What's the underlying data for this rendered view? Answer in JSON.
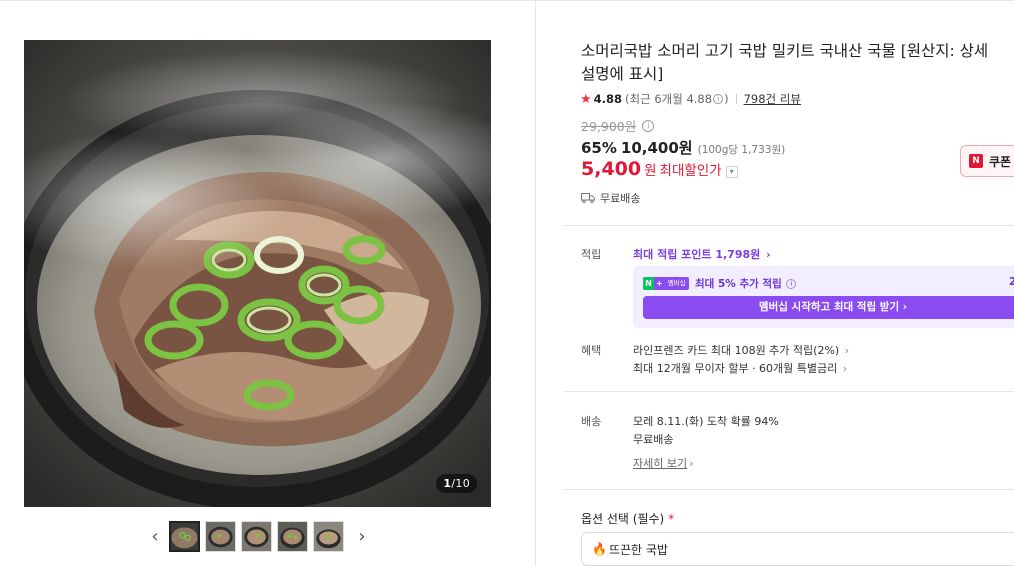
{
  "gallery": {
    "counter_current": "1",
    "counter_total": "/10",
    "prev_icon": "chevron-left-icon",
    "next_icon": "chevron-right-icon",
    "thumbnail_count": 5
  },
  "product": {
    "title": "소머리국밥 소머리 고기 국밥 밀키트 국내산 국물 [원산지: 상세설명에 표시]",
    "rating": "4.88",
    "recent_rating": "(최근 6개월 4.88",
    "recent_rating_close": ")",
    "review_count": "798건 리뷰",
    "original_price": "29,900원",
    "discount_rate": "65%",
    "sale_price": "10,400원",
    "unit_price": "(100g당 1,733원)",
    "max_discount_price": "5,400",
    "max_discount_unit": "원",
    "max_discount_label": "최대할인가",
    "shipping_short": "무료배송",
    "coupon_label": "쿠폰",
    "coupon_icon": "N"
  },
  "points": {
    "label": "적립",
    "link": "최대 적립 포인트 1,798원",
    "badge_n": "N",
    "badge_plus": "+",
    "badge_text": "멤버십",
    "extra": "최대 5% 추가 적립",
    "right_value": "2",
    "membership_button": "멤버십 시작하고 최대 적립 받기"
  },
  "benefits": {
    "label": "혜택",
    "card": "라인프렌즈 카드 최대 108원 추가 적립(2%)",
    "installment": "최대 12개월 무이자 할부 · 60개월 특별금리"
  },
  "delivery": {
    "label": "배송",
    "eta": "모레 8.11.(화) 도착 확률 94%",
    "fee": "무료배송",
    "detail_link": "자세히 보기"
  },
  "options": {
    "label": "옵션 선택 (필수)",
    "required_mark": "*",
    "selected": "뜨끈한 국밥",
    "selected_icon": "fire-icon"
  },
  "colors": {
    "accent_red": "#e01836",
    "membership_purple": "#8a4bf0",
    "points_purple": "#7b3fe4"
  }
}
